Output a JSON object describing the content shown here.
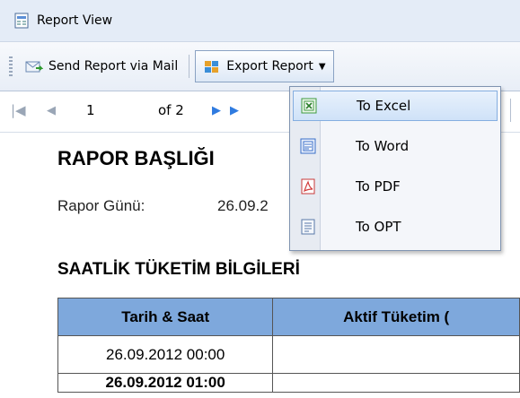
{
  "window": {
    "title": "Report View"
  },
  "toolbar": {
    "send_label": "Send Report via Mail",
    "export_label": "Export Report"
  },
  "navigation": {
    "current_page": "1",
    "of_text": "of 2"
  },
  "export_menu": {
    "items": [
      {
        "label": "To Excel",
        "icon": "excel-icon"
      },
      {
        "label": "To Word",
        "icon": "word-icon"
      },
      {
        "label": "To PDF",
        "icon": "pdf-icon"
      },
      {
        "label": "To OPT",
        "icon": "document-icon"
      }
    ]
  },
  "report": {
    "title": "RAPOR BAŞLIĞI",
    "date_label": "Rapor Günü:",
    "date_value": "26.09.2",
    "section_title": "SAATLİK TÜKETİM BİLGİLERİ",
    "columns": [
      "Tarih & Saat",
      "Aktif Tüketim ("
    ],
    "rows": [
      [
        "26.09.2012 00:00",
        ""
      ],
      [
        "26.09.2012 01:00",
        ""
      ]
    ]
  },
  "colors": {
    "table_header": "#7ea8dc",
    "menu_highlight": "#cfe2f8"
  }
}
